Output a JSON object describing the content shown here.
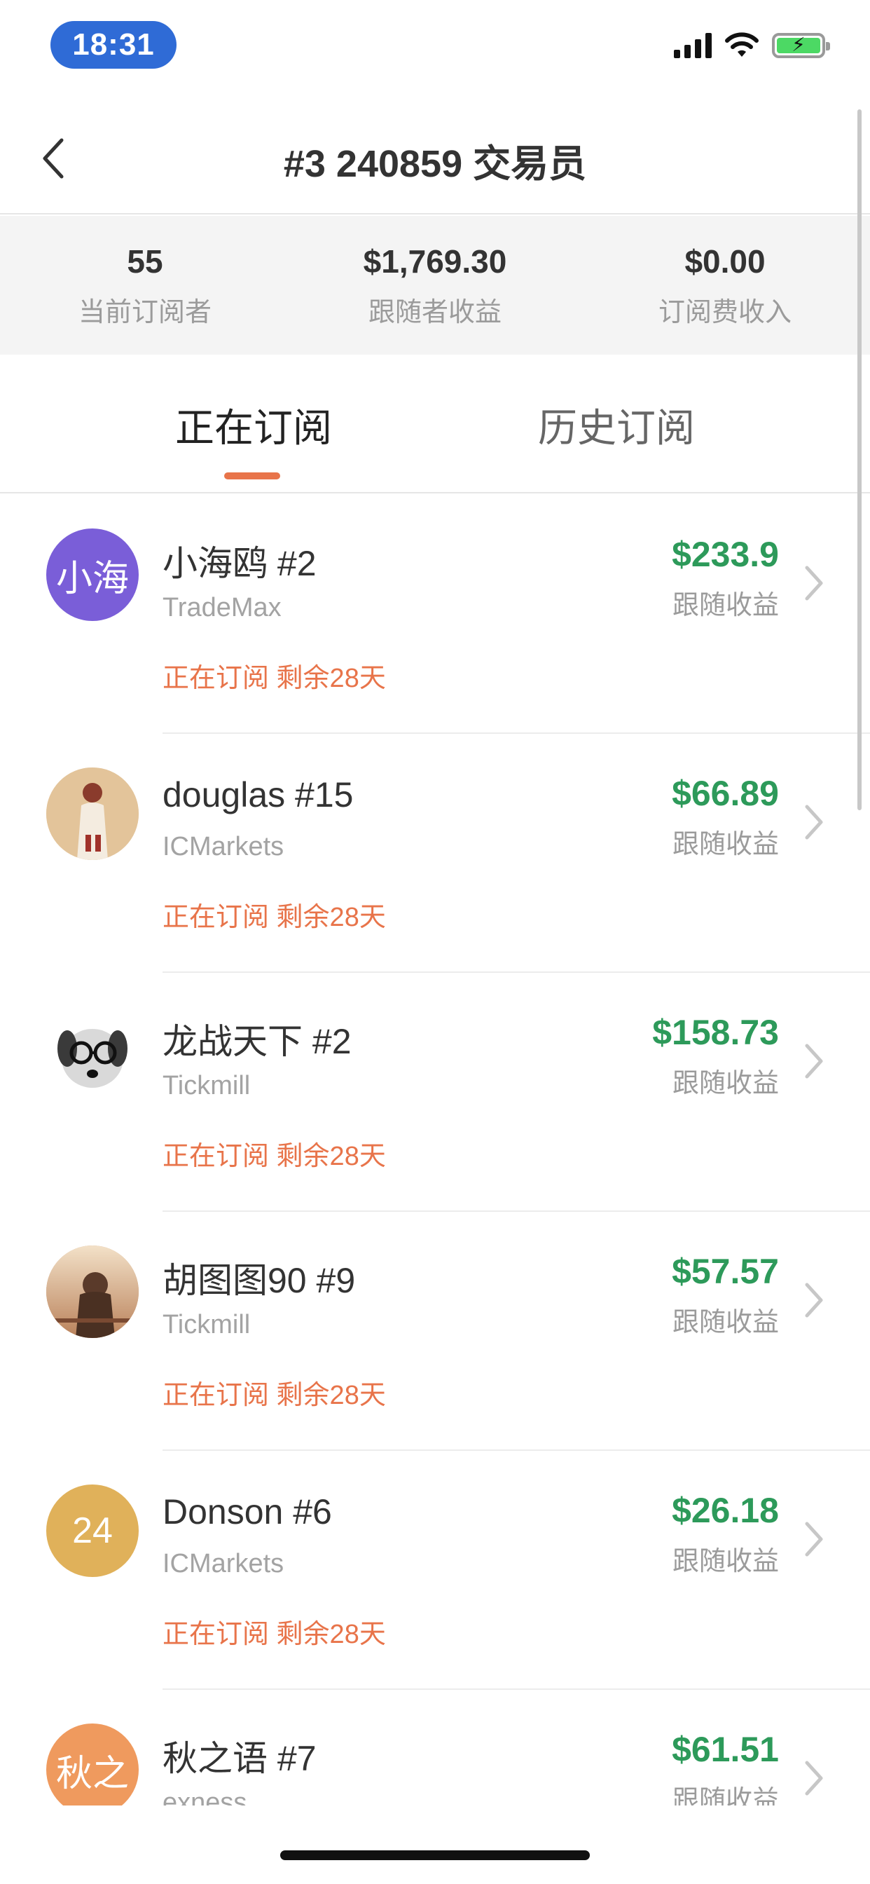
{
  "status_bar": {
    "time": "18:31"
  },
  "nav": {
    "title": "#3 240859 交易员"
  },
  "stats": [
    {
      "value": "55",
      "label": "当前订阅者"
    },
    {
      "value": "$1,769.30",
      "label": "跟随者收益"
    },
    {
      "value": "$0.00",
      "label": "订阅费收入"
    }
  ],
  "tabs": [
    {
      "label": "正在订阅",
      "active": true
    },
    {
      "label": "历史订阅",
      "active": false
    }
  ],
  "subscribers": [
    {
      "avatar_text": "小海",
      "avatar_color": "#7a5ed8",
      "name": "小海鸥 #2",
      "broker": "TradeMax",
      "status": "正在订阅 剩余28天",
      "amount": "$233.9",
      "amount_label": "跟随收益"
    },
    {
      "avatar_text": "",
      "avatar_color": "#d9b48a",
      "avatar_icon": "photo-portrait-woman",
      "name": "douglas #15",
      "broker": "ICMarkets",
      "status": "正在订阅 剩余28天",
      "amount": "$66.89",
      "amount_label": "跟随收益"
    },
    {
      "avatar_text": "",
      "avatar_color": "#ffffff",
      "avatar_icon": "photo-dog-glasses",
      "name": "龙战天下 #2",
      "broker": "Tickmill",
      "status": "正在订阅 剩余28天",
      "amount": "$158.73",
      "amount_label": "跟随收益"
    },
    {
      "avatar_text": "",
      "avatar_color": "#c99a6e",
      "avatar_icon": "photo-sunset-girl",
      "name": "胡图图90 #9",
      "broker": "Tickmill",
      "status": "正在订阅 剩余28天",
      "amount": "$57.57",
      "amount_label": "跟随收益"
    },
    {
      "avatar_text": "24",
      "avatar_color": "#e0b15a",
      "name": "Donson #6",
      "broker": "ICMarkets",
      "status": "正在订阅 剩余28天",
      "amount": "$26.18",
      "amount_label": "跟随收益"
    },
    {
      "avatar_text": "秋之",
      "avatar_color": "#ef9a5e",
      "name": "秋之语 #7",
      "broker": "exness",
      "status": "",
      "amount": "$61.51",
      "amount_label": "跟随收益"
    }
  ],
  "colors": {
    "accent": "#e8744a",
    "profit": "#2d9a5a",
    "muted": "#9b9b9b"
  }
}
